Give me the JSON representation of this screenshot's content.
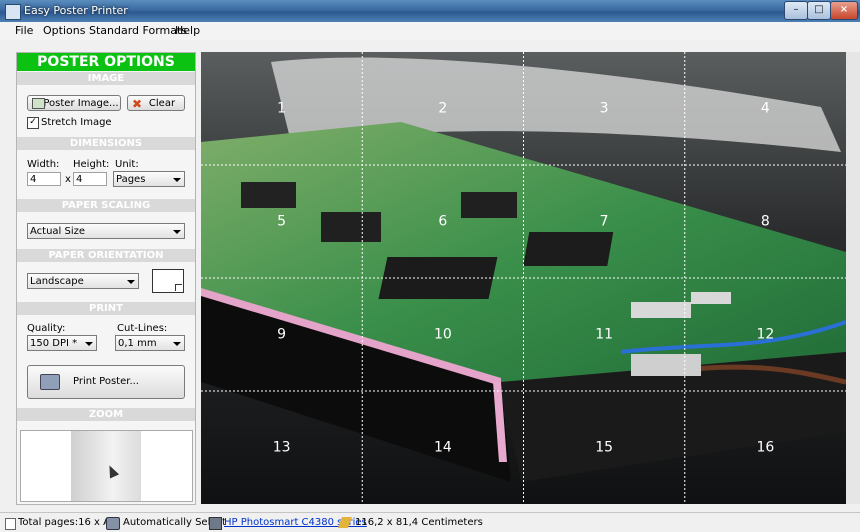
{
  "window": {
    "title": "Easy Poster Printer",
    "minimize": "–",
    "maximize": "□",
    "close": "×"
  },
  "menu": [
    "File",
    "Options",
    "Standard Formats",
    "Help"
  ],
  "panel": {
    "title": "POSTER OPTIONS",
    "image": {
      "header": "IMAGE",
      "poster_image_label": "Poster Image...",
      "clear_label": "Clear",
      "stretch_label": "Stretch Image",
      "stretch_checked": true
    },
    "dimensions": {
      "header": "DIMENSIONS",
      "width_label": "Width:",
      "width_value": "4",
      "height_label": "Height:",
      "height_value": "4",
      "separator": "x",
      "unit_label": "Unit:",
      "unit_value": "Pages"
    },
    "scaling": {
      "header": "PAPER SCALING",
      "value": "Actual Size"
    },
    "orientation": {
      "header": "PAPER ORIENTATION",
      "value": "Landscape"
    },
    "print": {
      "header": "PRINT",
      "quality_label": "Quality:",
      "quality_value": "150 DPI *",
      "cutlines_label": "Cut-Lines:",
      "cutlines_value": "0,1 mm",
      "print_button": "Print Poster..."
    },
    "zoom": {
      "header": "ZOOM"
    }
  },
  "tiles": [
    "1",
    "2",
    "3",
    "4",
    "5",
    "6",
    "7",
    "8",
    "9",
    "10",
    "11",
    "12",
    "13",
    "14",
    "15",
    "16"
  ],
  "status": {
    "pages": "Total pages:16 x A4",
    "auto": "Automatically Select",
    "printer": "HP Photosmart C4380 series",
    "size": "116,2 x 81,4 Centimeters"
  },
  "colors": {
    "accent_green": "#0bc112",
    "section_gray": "#d9d9d9",
    "link": "#0033cc"
  }
}
